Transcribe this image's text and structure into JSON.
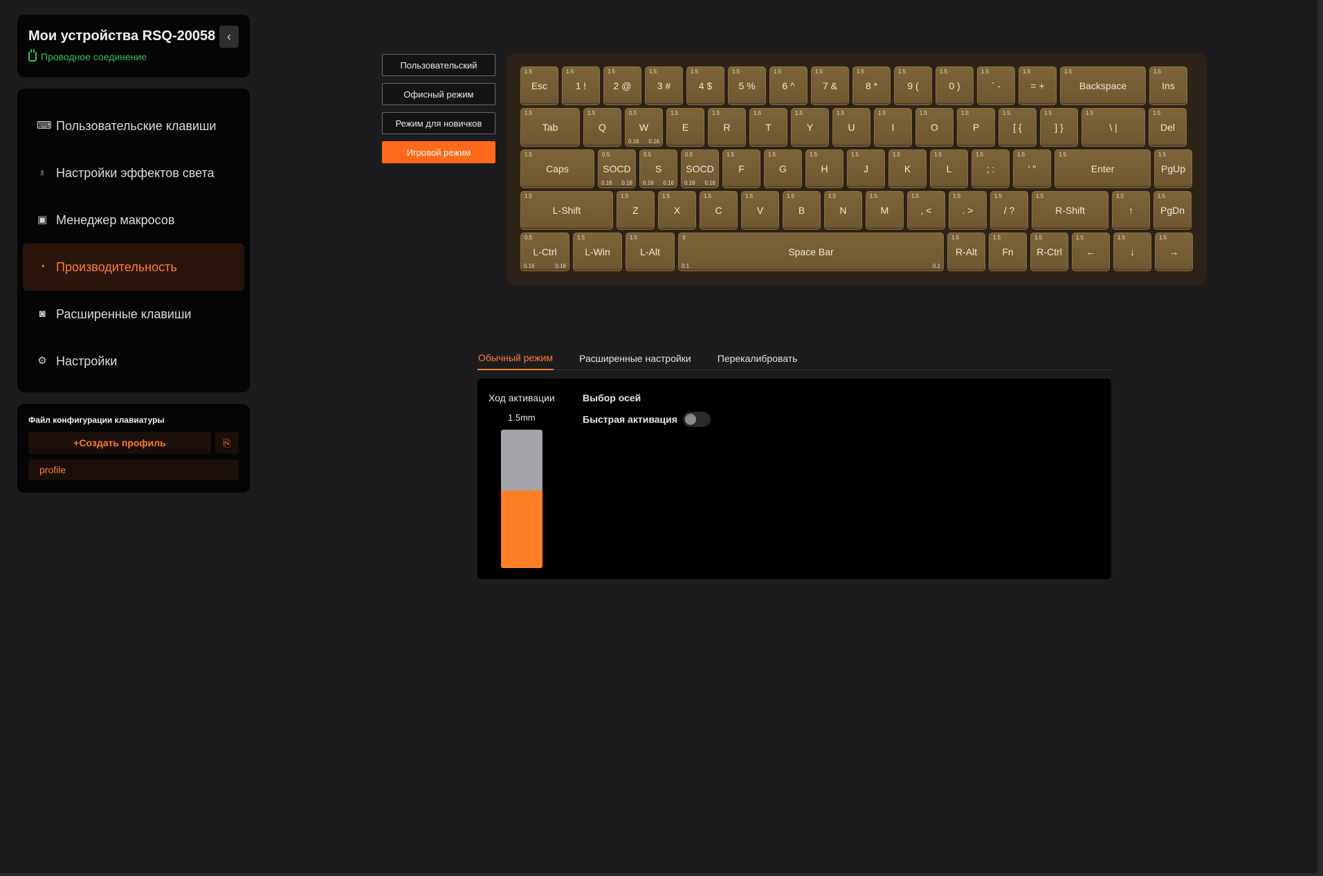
{
  "device": {
    "title": "Мои устройства RSQ-20058",
    "connection": "Проводное соединение",
    "collapse_icon": "chevron-left-icon"
  },
  "nav": {
    "items": [
      {
        "label": "Пользовательские клавиши",
        "icon": "keyboard-icon",
        "active": false
      },
      {
        "label": "Настройки эффектов света",
        "icon": "bulb-icon",
        "active": false
      },
      {
        "label": "Менеджер макросов",
        "icon": "macro-icon",
        "active": false
      },
      {
        "label": "Производительность",
        "icon": "gauge-icon",
        "active": true
      },
      {
        "label": "Расширенные клавиши",
        "icon": "advanced-key-icon",
        "active": false
      },
      {
        "label": "Настройки",
        "icon": "gear-icon",
        "active": false
      }
    ]
  },
  "profiles": {
    "heading": "Файл конфигурации клавиатуры",
    "create_label": "+Создать профиль",
    "items": [
      "profile"
    ]
  },
  "modes": {
    "items": [
      {
        "label": "Пользовательский",
        "active": false
      },
      {
        "label": "Офисный режим",
        "active": false
      },
      {
        "label": "Режим для новичков",
        "active": false
      },
      {
        "label": "Игровой режим",
        "active": true
      }
    ]
  },
  "keyboard": {
    "rows": [
      [
        {
          "label": "Esc",
          "ap": "1.5"
        },
        {
          "label": "1 !",
          "ap": "1.5"
        },
        {
          "label": "2 @",
          "ap": "1.5"
        },
        {
          "label": "3 #",
          "ap": "1.5"
        },
        {
          "label": "4 $",
          "ap": "1.5"
        },
        {
          "label": "5 %",
          "ap": "1.5"
        },
        {
          "label": "6 ^",
          "ap": "1.5"
        },
        {
          "label": "7 &",
          "ap": "1.5"
        },
        {
          "label": "8 *",
          "ap": "1.5"
        },
        {
          "label": "9 (",
          "ap": "1.5"
        },
        {
          "label": "0 )",
          "ap": "1.5"
        },
        {
          "label": "` -",
          "ap": "1.5"
        },
        {
          "label": "= +",
          "ap": "1.5"
        },
        {
          "label": "Backspace",
          "ap": "1.5"
        },
        {
          "label": "Ins",
          "ap": "1.5"
        }
      ],
      [
        {
          "label": "Tab",
          "ap": "1.5"
        },
        {
          "label": "Q",
          "ap": "1.5"
        },
        {
          "label": "W",
          "ap": "0.5",
          "bl": "0.16",
          "br": "0.16"
        },
        {
          "label": "E",
          "ap": "1.5"
        },
        {
          "label": "R",
          "ap": "1.5"
        },
        {
          "label": "T",
          "ap": "1.5"
        },
        {
          "label": "Y",
          "ap": "1.5"
        },
        {
          "label": "U",
          "ap": "1.5"
        },
        {
          "label": "I",
          "ap": "1.5"
        },
        {
          "label": "O",
          "ap": "1.5"
        },
        {
          "label": "P",
          "ap": "1.5"
        },
        {
          "label": "[ {",
          "ap": "1.5"
        },
        {
          "label": "] }",
          "ap": "1.5"
        },
        {
          "label": "\\ |",
          "ap": "1.5"
        },
        {
          "label": "Del",
          "ap": "1.5"
        }
      ],
      [
        {
          "label": "Caps",
          "ap": "1.5"
        },
        {
          "label": "SOCD",
          "ap": "0.5",
          "bl": "0.16",
          "br": "0.16"
        },
        {
          "label": "S",
          "ap": "0.5",
          "bl": "0.16",
          "br": "0.16"
        },
        {
          "label": "SOCD",
          "ap": "0.5",
          "bl": "0.16",
          "br": "0.16"
        },
        {
          "label": "F",
          "ap": "1.5"
        },
        {
          "label": "G",
          "ap": "1.5"
        },
        {
          "label": "H",
          "ap": "1.5"
        },
        {
          "label": "J",
          "ap": "1.5"
        },
        {
          "label": "K",
          "ap": "1.5"
        },
        {
          "label": "L",
          "ap": "1.5"
        },
        {
          "label": "; :",
          "ap": "1.5"
        },
        {
          "label": "' \"",
          "ap": "1.5"
        },
        {
          "label": "Enter",
          "ap": "1.5"
        },
        {
          "label": "PgUp",
          "ap": "1.5"
        }
      ],
      [
        {
          "label": "L-Shift",
          "ap": "1.5"
        },
        {
          "label": "Z",
          "ap": "1.5"
        },
        {
          "label": "X",
          "ap": "1.5"
        },
        {
          "label": "C",
          "ap": "1.5"
        },
        {
          "label": "V",
          "ap": "1.5"
        },
        {
          "label": "B",
          "ap": "1.5"
        },
        {
          "label": "N",
          "ap": "1.5"
        },
        {
          "label": "M",
          "ap": "1.5"
        },
        {
          "label": ", <",
          "ap": "1.5"
        },
        {
          "label": ". >",
          "ap": "1.5"
        },
        {
          "label": "/ ?",
          "ap": "1.5"
        },
        {
          "label": "R-Shift",
          "ap": "1.5"
        },
        {
          "label": "↑",
          "ap": "1.5"
        },
        {
          "label": "PgDn",
          "ap": "1.5"
        }
      ],
      [
        {
          "label": "L-Ctrl",
          "ap": "0.5",
          "bl": "0.16",
          "br": "0.16"
        },
        {
          "label": "L-Win",
          "ap": "1.5"
        },
        {
          "label": "L-Alt",
          "ap": "1.5"
        },
        {
          "label": "Space Bar",
          "ap": "3",
          "bl": "0.1",
          "br": "0.1"
        },
        {
          "label": "R-Alt",
          "ap": "1.5"
        },
        {
          "label": "Fn",
          "ap": "1.5"
        },
        {
          "label": "R-Ctrl",
          "ap": "1.5"
        },
        {
          "label": "←",
          "ap": "1.5"
        },
        {
          "label": "↓",
          "ap": "1.5"
        },
        {
          "label": "→",
          "ap": "1.5"
        }
      ]
    ]
  },
  "tabs": {
    "items": [
      {
        "label": "Обычный режим",
        "active": true
      },
      {
        "label": "Расширенные настройки",
        "active": false
      },
      {
        "label": "Перекалибровать",
        "active": false
      }
    ]
  },
  "panel": {
    "activation_label": "Ход активации",
    "activation_value": "1.5mm",
    "activation_fraction": 0.56,
    "axis_title": "Выбор осей",
    "rapid_label": "Быстрая активация",
    "rapid_enabled": false
  },
  "colors": {
    "accent": "#ff6a1a",
    "connected": "#33c25a",
    "key": "#7a6237"
  }
}
